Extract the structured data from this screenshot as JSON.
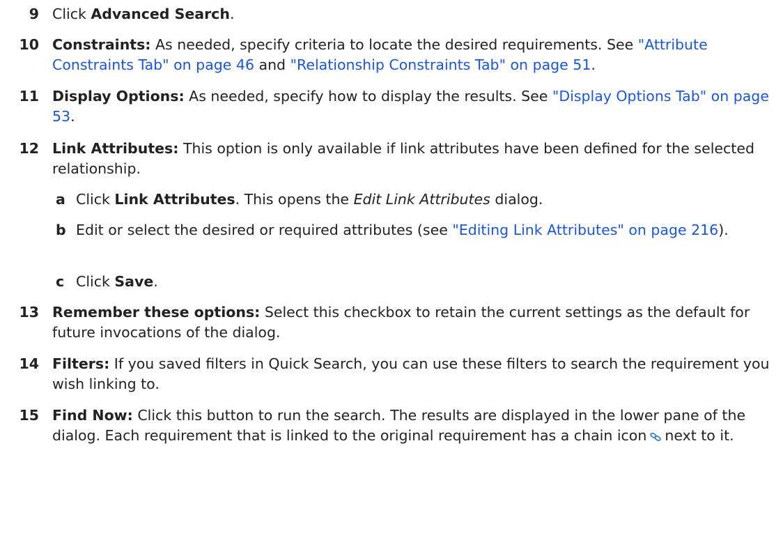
{
  "steps": [
    {
      "num": "9",
      "parts": [
        "Click ",
        "Advanced Search",
        "."
      ]
    },
    {
      "num": "10",
      "label": "Constraints:",
      "text": " As needed, specify criteria to locate the desired requirements. See ",
      "link1": "\"Attribute Constraints Tab\" on page 46",
      "mid": " and ",
      "link2": "\"Relationship Constraints Tab\" on page 51",
      "end": "."
    },
    {
      "num": "11",
      "label": "Display Options:",
      "text": " As needed, specify how to display the results. See ",
      "link": "\"Display Options Tab\" on page 53",
      "end": "."
    },
    {
      "num": "12",
      "label": "Link Attributes:",
      "text": " This option is only available if link attributes have been defined for the selected relationship.",
      "substeps": [
        {
          "letter": "a",
          "pre": "Click ",
          "bold": "Link Attributes",
          "mid": ". This opens the ",
          "italic": "Edit Link Attributes",
          "end": " dialog."
        },
        {
          "letter": "b",
          "pre": "Edit or select the desired or required attributes (see ",
          "link": "\"Editing Link Attributes\" on page 216",
          "end": ")."
        },
        {
          "letter": "c",
          "pre": "Click ",
          "bold": "Save",
          "end": "."
        }
      ]
    },
    {
      "num": "13",
      "label": "Remember these options:",
      "text": " Select this checkbox to retain the current settings as the default for future invocations of the dialog."
    },
    {
      "num": "14",
      "label": "Filters:",
      "text": " If you saved filters in Quick Search, you can use these filters to search the requirement you wish linking to."
    },
    {
      "num": "15",
      "label": "Find Now:",
      "text": " Click this button to run the search. The results are displayed in the lower pane of the dialog. Each requirement that is linked to the original requirement has a chain icon",
      "icon": "chain-link-icon",
      "end": "next to it."
    }
  ],
  "colors": {
    "link": "#1a56d6",
    "text": "#222222",
    "icon": "#3a86d8"
  }
}
